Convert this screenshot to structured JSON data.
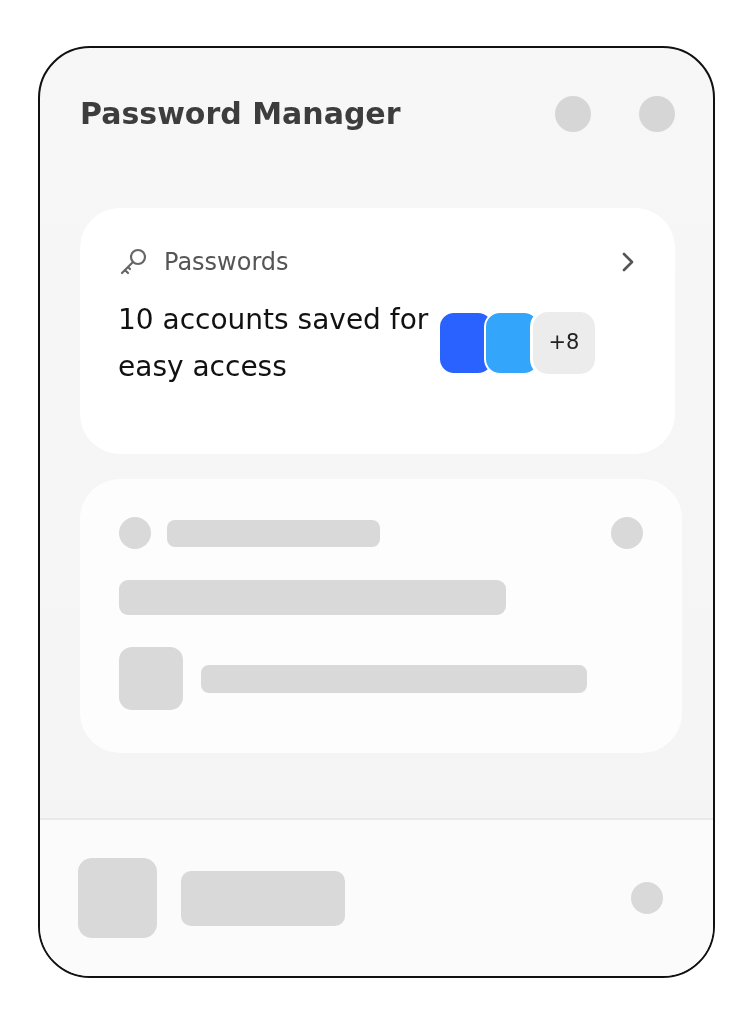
{
  "window": {
    "title": "Password Manager"
  },
  "passwords_card": {
    "label": "Passwords",
    "summary": "10 accounts saved for easy access",
    "accounts": [
      {
        "color": "#2962ff"
      },
      {
        "color": "#33a6fb"
      }
    ],
    "more_count": "+8"
  }
}
